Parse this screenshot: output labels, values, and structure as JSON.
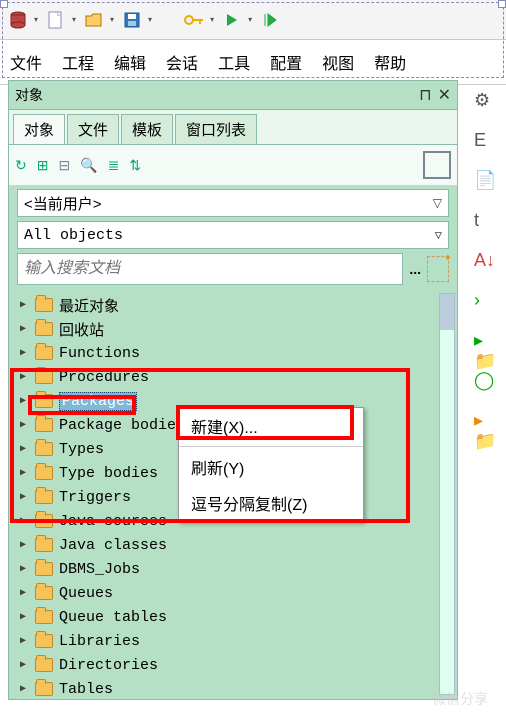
{
  "menu": {
    "file": "文件",
    "project": "工程",
    "edit": "编辑",
    "session": "会话",
    "tools": "工具",
    "config": "配置",
    "view": "视图",
    "help": "帮助"
  },
  "panel": {
    "title": "对象",
    "tabs": {
      "objects": "对象",
      "files": "文件",
      "templates": "模板",
      "window_list": "窗口列表"
    }
  },
  "user_combo": "<当前用户>",
  "filter_combo": "All objects",
  "search_placeholder": "输入搜索文档",
  "search_dots": "...",
  "tree": [
    {
      "label": "最近对象"
    },
    {
      "label": "回收站"
    },
    {
      "label": "Functions"
    },
    {
      "label": "Procedures"
    },
    {
      "label": "Packages",
      "selected": true
    },
    {
      "label": "Package bodies"
    },
    {
      "label": "Types"
    },
    {
      "label": "Type bodies"
    },
    {
      "label": "Triggers"
    },
    {
      "label": "Java sources"
    },
    {
      "label": "Java classes"
    },
    {
      "label": "DBMS_Jobs"
    },
    {
      "label": "Queues"
    },
    {
      "label": "Queue tables"
    },
    {
      "label": "Libraries"
    },
    {
      "label": "Directories"
    },
    {
      "label": "Tables"
    }
  ],
  "context_menu": {
    "new": "新建(X)...",
    "refresh": "刷新(Y)",
    "copy": "逗号分隔复制(Z)"
  },
  "right_labels": {
    "e": "E",
    "t": "t"
  },
  "watermark": "微信分享"
}
